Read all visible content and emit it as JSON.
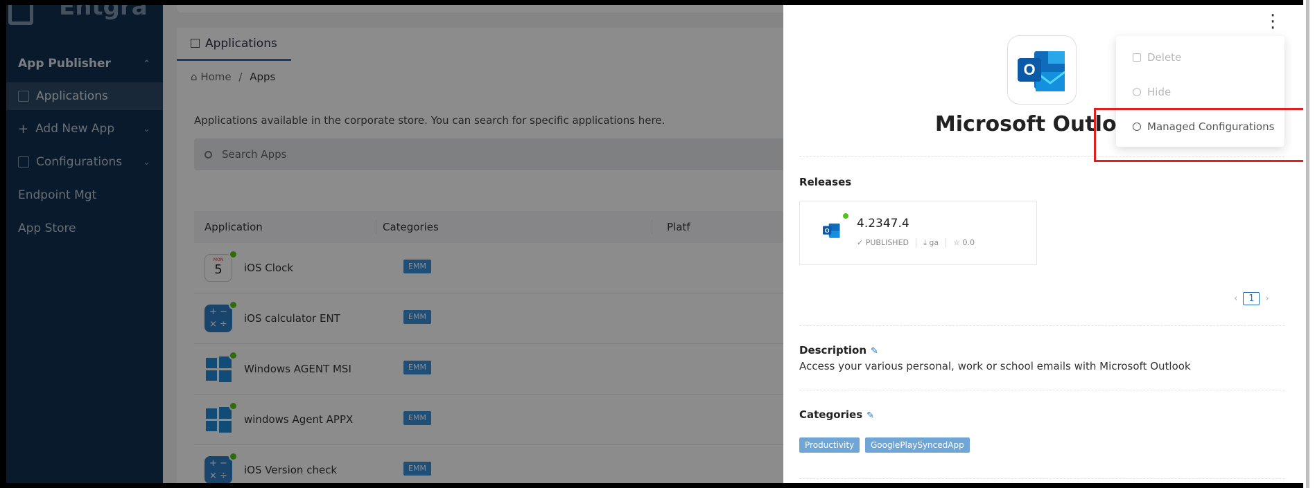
{
  "brand": {
    "logo_text": "Entgra"
  },
  "sidebar": {
    "items": [
      {
        "label": "App Publisher",
        "chevron": "⌃"
      },
      {
        "label": "Applications"
      },
      {
        "label": "Add New App",
        "chevron": "⌄"
      },
      {
        "label": "Configurations",
        "chevron": "⌄"
      },
      {
        "label": "Endpoint Mgt"
      },
      {
        "label": "App Store"
      }
    ]
  },
  "main": {
    "tab_label": "Applications",
    "breadcrumb": {
      "home": "Home",
      "sep": "/",
      "current": "Apps"
    },
    "intro": "Applications available in the corporate store. You can search for specific applications here.",
    "search_placeholder": "Search Apps",
    "table": {
      "columns": [
        "Application",
        "Categories",
        "Platf"
      ],
      "rows": [
        {
          "name": "iOS Clock",
          "tag": "EMM",
          "icon": "clock-icon"
        },
        {
          "name": "iOS calculator ENT",
          "tag": "EMM",
          "icon": "calculator-icon"
        },
        {
          "name": "Windows AGENT MSI",
          "tag": "EMM",
          "icon": "windows-icon"
        },
        {
          "name": "windows Agent APPX",
          "tag": "EMM",
          "icon": "windows-icon"
        },
        {
          "name": "iOS Version check",
          "tag": "EMM",
          "icon": "calculator-icon"
        }
      ],
      "clock_month": "MON",
      "clock_day": "5"
    }
  },
  "drawer": {
    "title": "Microsoft Outlook",
    "releases_heading": "Releases",
    "release": {
      "version": "4.2347.4",
      "status": "PUBLISHED",
      "channel": "ga",
      "rating": "0.0"
    },
    "pager_current": "1",
    "description_heading": "Description",
    "description": "Access your various personal, work or school emails with Microsoft Outlook",
    "categories_heading": "Categories",
    "categories": [
      "Productivity",
      "GooglePlaySyncedApp"
    ]
  },
  "menu": {
    "items": [
      {
        "label": "Delete",
        "icon": "trash-icon"
      },
      {
        "label": "Hide",
        "icon": "eye-off-icon"
      },
      {
        "label": "Managed Configurations",
        "icon": "gear-icon"
      }
    ]
  },
  "colors": {
    "sidebar_bg": "#0f3050",
    "accent": "#2a6fb8",
    "highlight": "#e02020",
    "tag_bg": "#6fa6d6"
  }
}
